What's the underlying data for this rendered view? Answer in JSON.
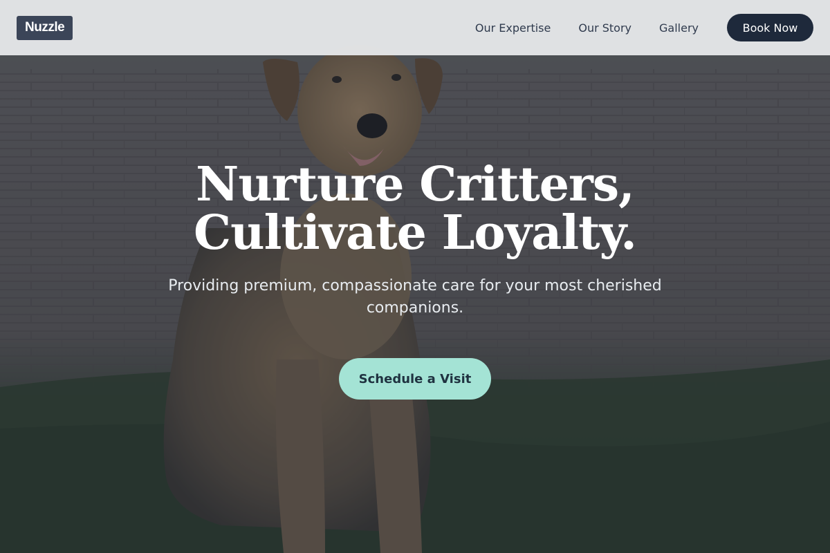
{
  "header": {
    "logo": "Nuzzle",
    "nav": [
      "Our Expertise",
      "Our Story",
      "Gallery"
    ],
    "cta": "Book Now"
  },
  "hero": {
    "title_line1": "Nurture Critters,",
    "title_line2": "Cultivate Loyalty.",
    "subtitle": "Providing premium, compassionate care for your most cherished companions.",
    "cta": "Schedule a Visit",
    "background_image": "dog-sitting-on-path-photo"
  },
  "colors": {
    "header_bg": "#eceef0",
    "logo_bg": "#3b4558",
    "nav_text": "#2f3a4d",
    "book_button_bg": "#1e293b",
    "cta_bg": "#a4e3d5",
    "cta_text": "#1f3240",
    "hero_text": "#ffffff"
  }
}
